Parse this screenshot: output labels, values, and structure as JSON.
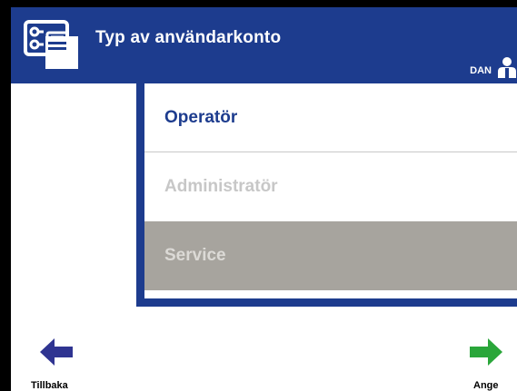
{
  "header": {
    "title": "Typ av användarkonto",
    "icon": "user-account-card-icon",
    "user_label": "DAN",
    "user_icon": "person-icon",
    "background_color": "#1d3c8e"
  },
  "account_types": [
    {
      "label": "Operatör",
      "state": "selected",
      "color": "#1d3c8e"
    },
    {
      "label": "Administratör",
      "state": "disabled",
      "color": "#c7c7c7"
    },
    {
      "label": "Service",
      "state": "disabled",
      "color": "#dcdad6"
    }
  ],
  "nav": {
    "back_label": "Tillbaka",
    "back_icon": "arrow-left-icon",
    "back_color": "#2f3491",
    "enter_label": "Ange",
    "enter_icon": "arrow-right-icon",
    "enter_color": "#2aa63a"
  }
}
